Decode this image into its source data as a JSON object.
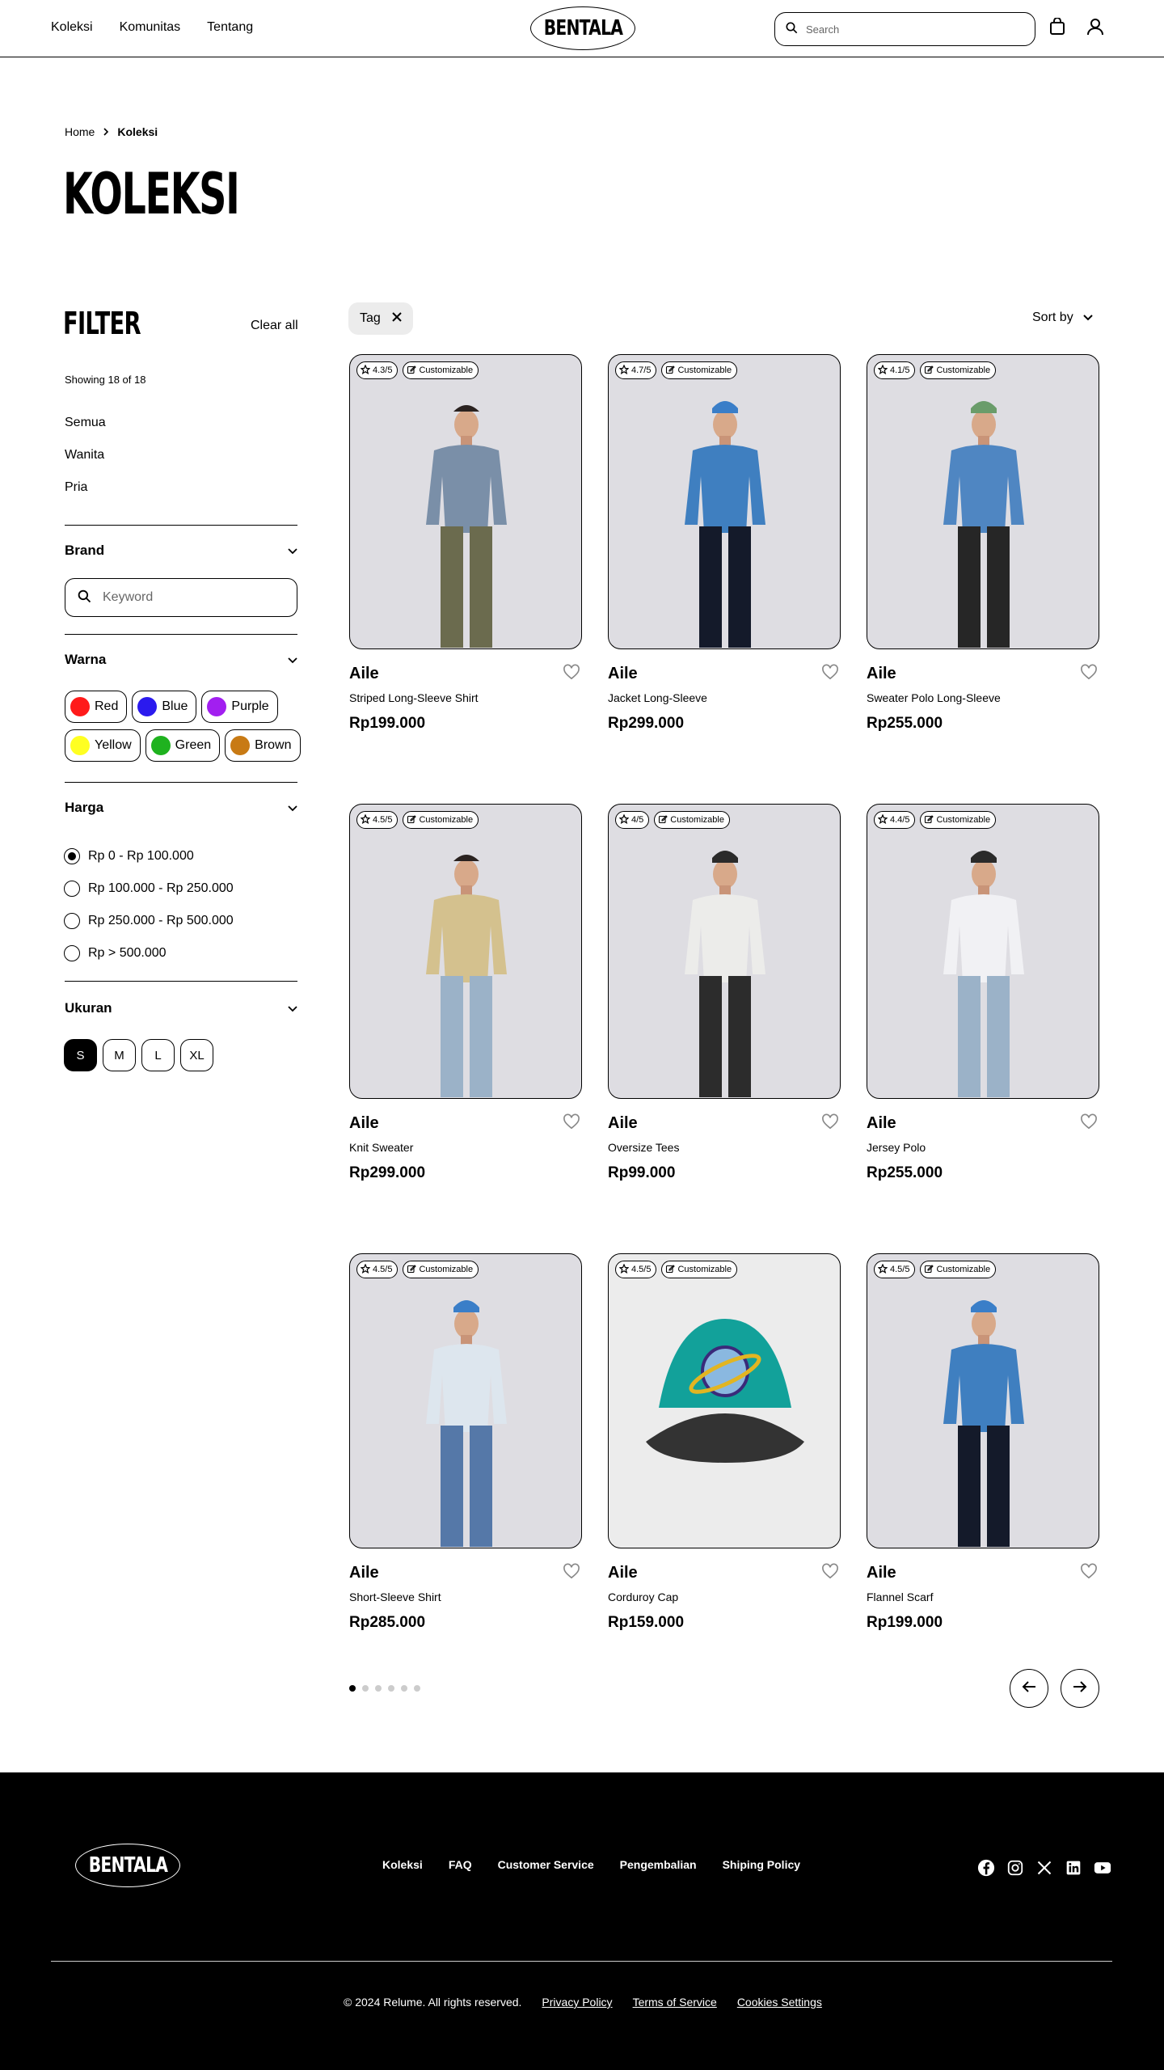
{
  "nav": {
    "links": [
      "Koleksi",
      "Komunitas",
      "Tentang"
    ],
    "logo": "BENTALA",
    "search_placeholder": "Search"
  },
  "breadcrumb": {
    "home": "Home",
    "current": "Koleksi"
  },
  "page_title": "KOLEKSI",
  "filter": {
    "title": "FILTER",
    "clear_all": "Clear all",
    "showing": "Showing 18 of 18",
    "categories": [
      "Semua",
      "Wanita",
      "Pria"
    ],
    "brand": {
      "label": "Brand",
      "placeholder": "Keyword"
    },
    "color": {
      "label": "Warna",
      "options": [
        {
          "name": "Red",
          "hex": "#ff1a1a"
        },
        {
          "name": "Blue",
          "hex": "#2b1aee"
        },
        {
          "name": "Purple",
          "hex": "#a21ff0"
        },
        {
          "name": "Yellow",
          "hex": "#ffff22"
        },
        {
          "name": "Green",
          "hex": "#1fb21f"
        },
        {
          "name": "Brown",
          "hex": "#c87a14"
        }
      ]
    },
    "price": {
      "label": "Harga",
      "options": [
        "Rp 0 - Rp 100.000",
        "Rp 100.000 - Rp 250.000",
        "Rp 250.000 - Rp 500.000",
        "Rp > 500.000"
      ],
      "selected_index": 0
    },
    "size": {
      "label": "Ukuran",
      "options": [
        "S",
        "M",
        "L",
        "XL"
      ],
      "selected": "S"
    }
  },
  "toolbar": {
    "tag": "Tag",
    "sort": "Sort by"
  },
  "customizable_label": "Customizable",
  "products": [
    {
      "rating": "4.3/5",
      "brand": "Aile",
      "name": "Striped Long-Sleeve Shirt",
      "price": "Rp199.000",
      "top": "#7a8fa8",
      "bottom": "#6b6b4e",
      "head": "none"
    },
    {
      "rating": "4.7/5",
      "brand": "Aile",
      "name": "Jacket Long-Sleeve",
      "price": "Rp299.000",
      "top": "#3f7fc0",
      "bottom": "#141a2a",
      "head": "#3a7ec8"
    },
    {
      "rating": "4.1/5",
      "brand": "Aile",
      "name": "Sweater Polo Long-Sleeve",
      "price": "Rp255.000",
      "top": "#4f86c2",
      "bottom": "#262626",
      "head": "#6a9c6a"
    },
    {
      "rating": "4.5/5",
      "brand": "Aile",
      "name": "Knit Sweater",
      "price": "Rp299.000",
      "top": "#d4c18e",
      "bottom": "#9bb2c8",
      "head": "none"
    },
    {
      "rating": "4/5",
      "brand": "Aile",
      "name": "Oversize Tees",
      "price": "Rp99.000",
      "top": "#ececea",
      "bottom": "#2c2c2c",
      "head": "#2a2a2a"
    },
    {
      "rating": "4.4/5",
      "brand": "Aile",
      "name": "Jersey Polo",
      "price": "Rp255.000",
      "top": "#f1f1f4",
      "bottom": "#9bb2c8",
      "head": "#2a2a2a"
    },
    {
      "rating": "4.5/5",
      "brand": "Aile",
      "name": "Short-Sleeve Shirt",
      "price": "Rp285.000",
      "top": "#dde6ee",
      "bottom": "#5578a8",
      "head": "#3a7ec8"
    },
    {
      "rating": "4.5/5",
      "brand": "Aile",
      "name": "Corduroy Cap",
      "price": "Rp159.000",
      "top": "#12a19a",
      "bottom": "#333333",
      "head": "cap"
    },
    {
      "rating": "4.5/5",
      "brand": "Aile",
      "name": "Flannel Scarf",
      "price": "Rp199.000",
      "top": "#3f7fc0",
      "bottom": "#141a2a",
      "head": "#3a7ec8"
    }
  ],
  "pagination": {
    "pages": 6,
    "current": 1
  },
  "footer": {
    "logo": "BENTALA",
    "links": [
      "Koleksi",
      "FAQ",
      "Customer Service",
      "Pengembalian",
      "Shiping Policy"
    ],
    "social": [
      "facebook-icon",
      "instagram-icon",
      "x-icon",
      "linkedin-icon",
      "youtube-icon"
    ],
    "copyright": "© 2024 Relume. All rights reserved.",
    "legal": [
      "Privacy Policy",
      "Terms of Service",
      "Cookies Settings"
    ]
  }
}
